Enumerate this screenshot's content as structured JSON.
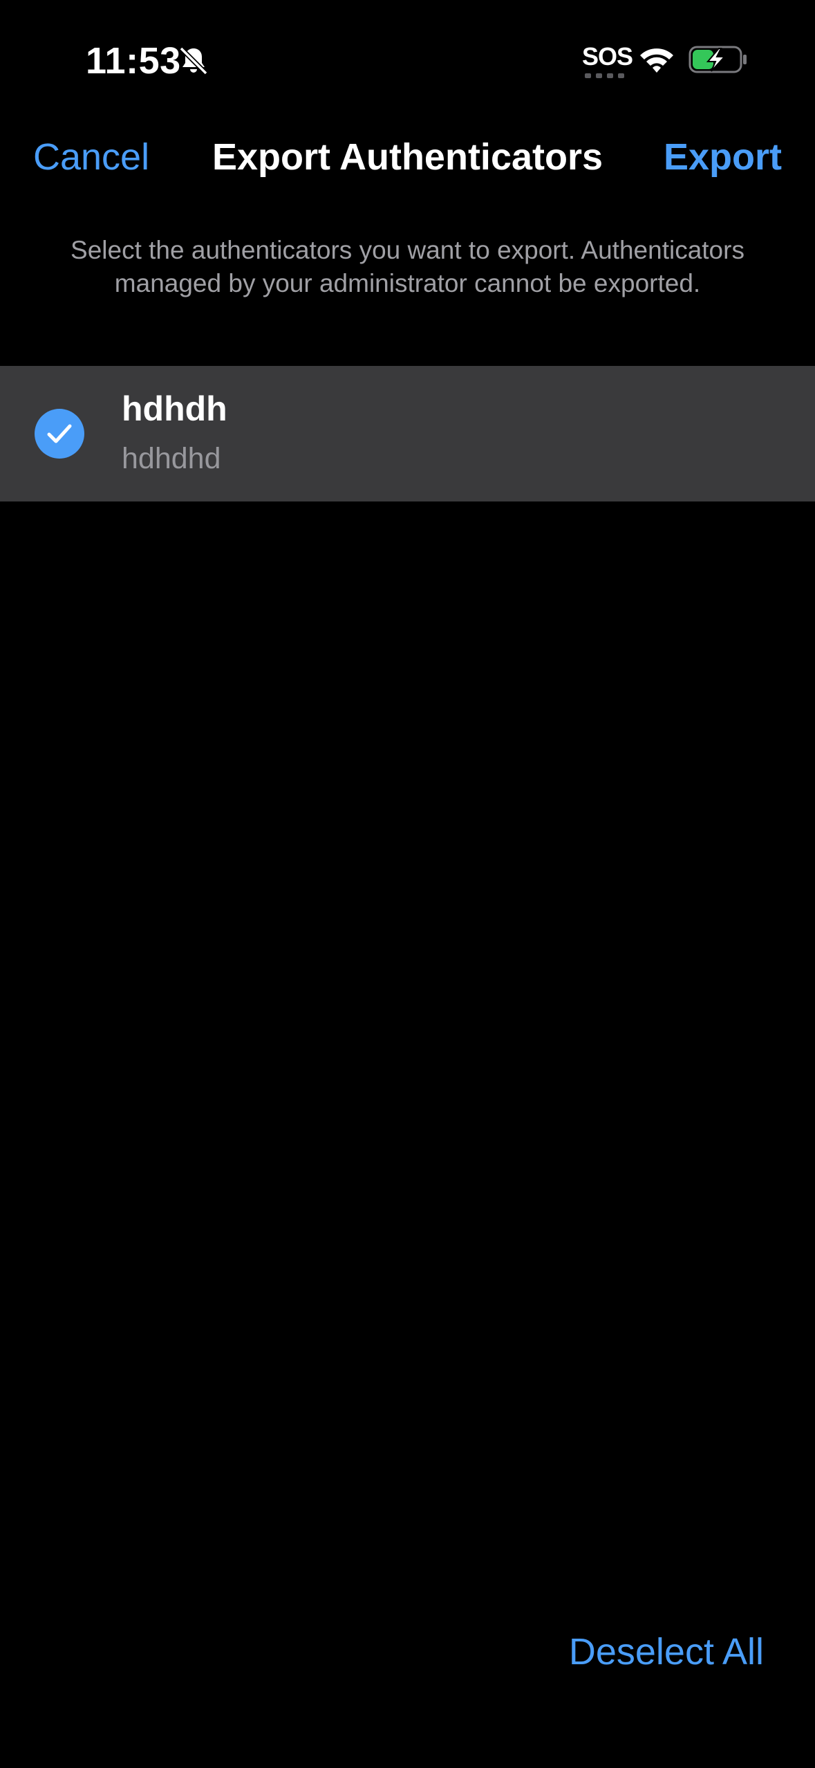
{
  "status_bar": {
    "time": "11:53",
    "carrier": "SOS",
    "icons": [
      "bell-slash-icon",
      "wifi-icon",
      "battery-charging-icon"
    ]
  },
  "nav": {
    "cancel_label": "Cancel",
    "title": "Export Authenticators",
    "export_label": "Export"
  },
  "description": "Select the authenticators you want to export. Authenticators managed by your administrator cannot be exported.",
  "authenticators": [
    {
      "title": "hdhdh",
      "subtitle": "hdhdhd",
      "selected": true
    }
  ],
  "footer": {
    "deselect_all_label": "Deselect All"
  },
  "colors": {
    "background": "#000000",
    "accent": "#4a9df8",
    "row_background": "#3a3a3c",
    "secondary_text": "#98989d",
    "battery_green": "#34c759"
  }
}
